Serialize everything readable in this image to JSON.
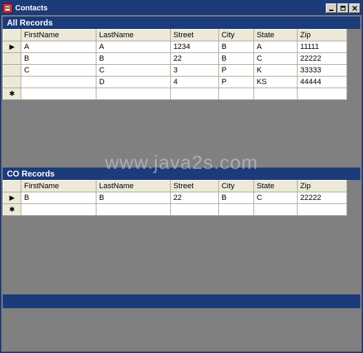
{
  "window": {
    "title": "Contacts"
  },
  "watermark": "www.java2s.com",
  "grids": {
    "all": {
      "title": "All Records",
      "columns": [
        "FirstName",
        "LastName",
        "Street",
        "City",
        "State",
        "Zip"
      ],
      "rows": [
        {
          "indicator": "▶",
          "cells": [
            "A",
            "A",
            "1234",
            "B",
            "A",
            "11111"
          ]
        },
        {
          "indicator": "",
          "cells": [
            "B",
            "B",
            "22",
            "B",
            "C",
            "22222"
          ]
        },
        {
          "indicator": "",
          "cells": [
            "C",
            "C",
            "3",
            "P",
            "K",
            "33333"
          ]
        },
        {
          "indicator": "",
          "cells": [
            "",
            "D",
            "4",
            "P",
            "KS",
            "44444"
          ]
        },
        {
          "indicator": "✱",
          "cells": [
            "",
            "",
            "",
            "",
            "",
            ""
          ]
        }
      ]
    },
    "co": {
      "title": "CO Records",
      "columns": [
        "FirstName",
        "LastName",
        "Street",
        "City",
        "State",
        "Zip"
      ],
      "rows": [
        {
          "indicator": "▶",
          "cells": [
            "B",
            "B",
            "22",
            "B",
            "C",
            "22222"
          ]
        },
        {
          "indicator": "✱",
          "cells": [
            "",
            "",
            "",
            "",
            "",
            ""
          ]
        }
      ]
    }
  }
}
